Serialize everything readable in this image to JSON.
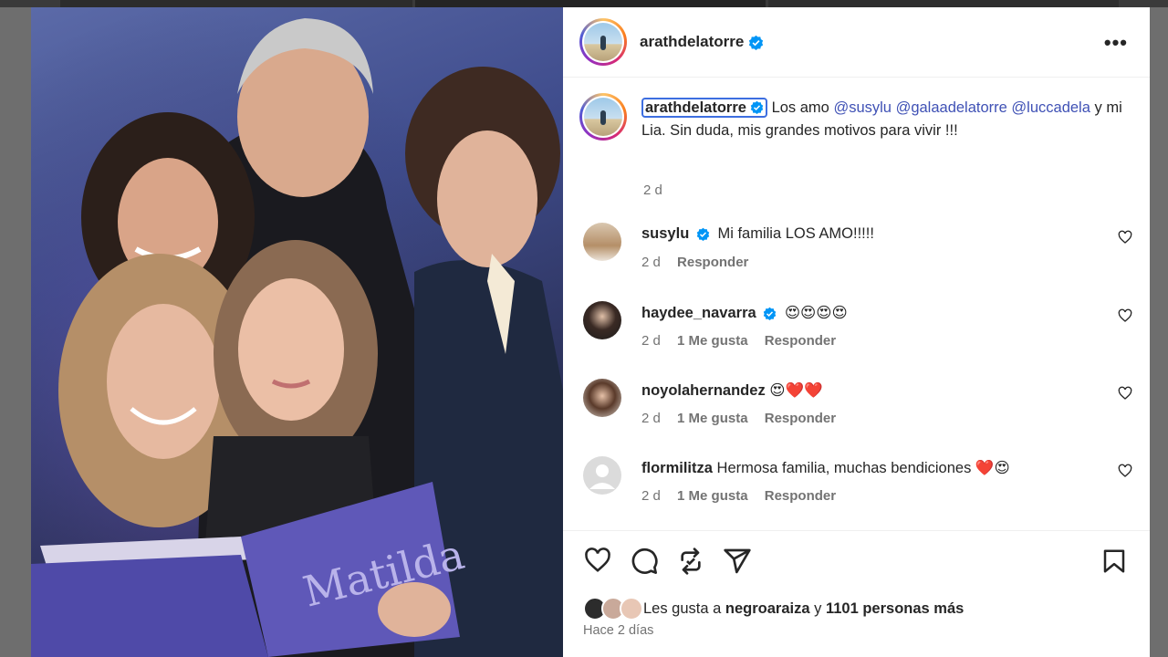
{
  "post": {
    "author": "arathdelatorre",
    "more_icon": "•••"
  },
  "caption": {
    "username": "arathdelatorre",
    "text_1": "Los amo",
    "mention_1": "@susylu",
    "mention_2": "@galaadelatorre",
    "mention_3": "@luccadela",
    "text_2": "y mi Lia. Sin duda, mis grandes motivos para vivir !!!",
    "time": "2 d"
  },
  "comments": [
    {
      "username": "susylu",
      "verified": true,
      "text": "Mi familia LOS AMO!!!!!",
      "time": "2 d",
      "likes": "",
      "reply": "Responder"
    },
    {
      "username": "haydee_navarra",
      "verified": true,
      "text": "😍😍😍😍",
      "time": "2 d",
      "likes": "1 Me gusta",
      "reply": "Responder"
    },
    {
      "username": "noyolahernandez",
      "verified": false,
      "text": "😍❤️❤️",
      "time": "2 d",
      "likes": "1 Me gusta",
      "reply": "Responder"
    },
    {
      "username": "flormilitza",
      "verified": false,
      "text": "Hermosa familia, muchas bendiciones ❤️😍",
      "time": "2 d",
      "likes": "1 Me gusta",
      "reply": "Responder"
    }
  ],
  "likes": {
    "prefix": "Les gusta a",
    "user": "negroaraiza",
    "conj": "y",
    "count": "1101 personas más"
  },
  "posted": "Hace 2 días",
  "icons": [
    "heart-icon",
    "comment-icon",
    "repost-icon",
    "share-icon",
    "bookmark-icon",
    "verified-badge-icon"
  ],
  "colors": {
    "link": "#3f51b5",
    "verified": "#0095f6",
    "muted": "#737373",
    "focus": "#3d6ee0"
  }
}
